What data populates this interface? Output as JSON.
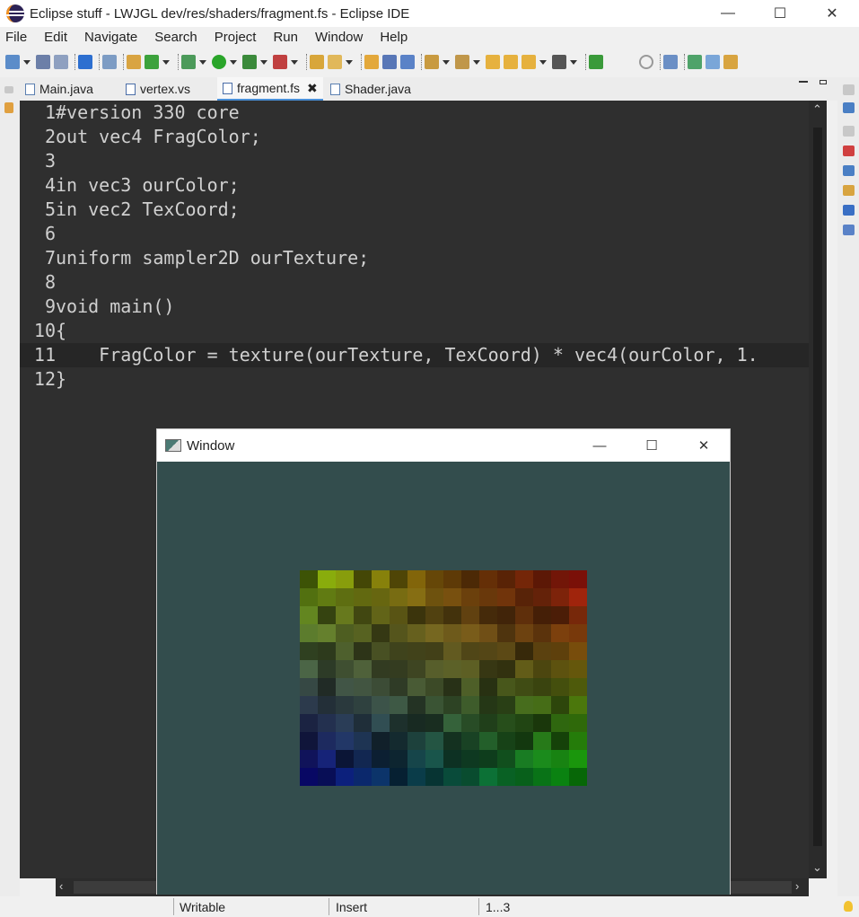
{
  "titlebar": {
    "title": "Eclipse stuff - LWJGL dev/res/shaders/fragment.fs - Eclipse IDE",
    "minimize": "—",
    "maximize": "☐",
    "close": "✕"
  },
  "menu": {
    "items": [
      "File",
      "Edit",
      "Navigate",
      "Search",
      "Project",
      "Run",
      "Window",
      "Help"
    ]
  },
  "tabs": [
    {
      "label": "Main.java"
    },
    {
      "label": "vertex.vs"
    },
    {
      "label": "fragment.fs",
      "close": "✖"
    },
    {
      "label": "Shader.java"
    }
  ],
  "editor": {
    "lines": [
      {
        "n": "1",
        "text": "#version 330 core"
      },
      {
        "n": "2",
        "text": "out vec4 FragColor;"
      },
      {
        "n": "3",
        "text": ""
      },
      {
        "n": "4",
        "text": "in vec3 ourColor;"
      },
      {
        "n": "5",
        "text": "in vec2 TexCoord;"
      },
      {
        "n": "6",
        "text": ""
      },
      {
        "n": "7",
        "text": "uniform sampler2D ourTexture;"
      },
      {
        "n": "8",
        "text": ""
      },
      {
        "n": "9",
        "text": "void main()"
      },
      {
        "n": "10",
        "text": "{"
      },
      {
        "n": "11",
        "text": "    FragColor = texture(ourTexture, TexCoord) * vec4(ourColor, 1."
      },
      {
        "n": "12",
        "text": "}"
      }
    ]
  },
  "statusbar": {
    "writable": "Writable",
    "insert": "Insert",
    "position": "1...3"
  },
  "float_window": {
    "title": "Window",
    "minimize": "—",
    "maximize": "☐",
    "close": "✕",
    "background": "#334d4d"
  }
}
